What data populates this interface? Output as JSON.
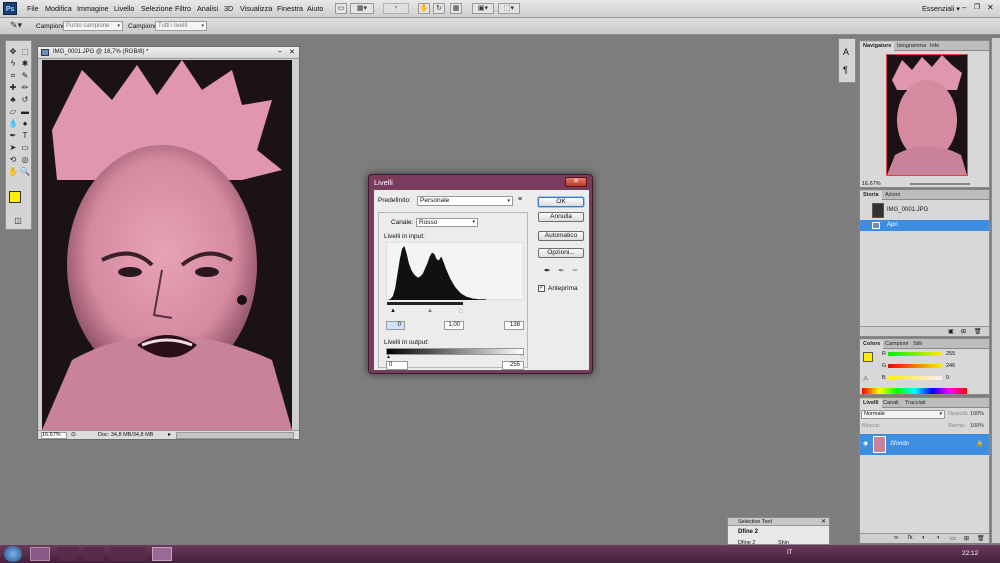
{
  "app": {
    "logo": "Ps"
  },
  "menu": [
    "File",
    "Modifica",
    "Immagine",
    "Livello",
    "Selezione",
    "Filtro",
    "Analisi",
    "3D",
    "Visualizza",
    "Finestra",
    "Aiuto"
  ],
  "workspace": "Essenziali",
  "options": {
    "campione_label": "Campione:",
    "campione_value": "Punto campione",
    "campione2_label": "Campione:",
    "campione2_value": "Tutti i livelli"
  },
  "document": {
    "title": "IMG_0001.JPG @ 16,7% (RGB/8) *",
    "zoom": "16,67%",
    "doc_info": "Doc: 34,8 MB/34,8 MB"
  },
  "dialog": {
    "title": "Livelli",
    "preset_label": "Predefinito:",
    "preset_value": "Personale",
    "channel_label": "Canale:",
    "channel_value": "Rosso",
    "input_label": "Livelli in input:",
    "input_black": "0",
    "input_gamma": "1,00",
    "input_white": "138",
    "output_label": "Livelli in output:",
    "output_black": "0",
    "output_white": "255",
    "buttons": {
      "ok": "OK",
      "cancel": "Annulla",
      "auto": "Automatico",
      "options": "Opzioni..."
    },
    "preview_label": "Anteprima",
    "preview_checked": true,
    "histogram": [
      0,
      0,
      2,
      6,
      18,
      40,
      62,
      78,
      82,
      70,
      55,
      46,
      40,
      36,
      34,
      36,
      40,
      48,
      56,
      66,
      72,
      70,
      62,
      60,
      66,
      58,
      48,
      40,
      32,
      26,
      20,
      16,
      12,
      9,
      7,
      5,
      4,
      3,
      2,
      2,
      1,
      1,
      1,
      1,
      0,
      0,
      0,
      0,
      0,
      0,
      0,
      0,
      0,
      0,
      0,
      0,
      0,
      0,
      0,
      0
    ]
  },
  "navigator": {
    "tabs": [
      "Navigatore",
      "Istogramma",
      "Info"
    ],
    "zoom": "16,67%"
  },
  "history": {
    "tabs": [
      "Storia",
      "Azioni"
    ],
    "items": [
      {
        "label": "IMG_0001.JPG"
      },
      {
        "label": "Apri"
      }
    ]
  },
  "color": {
    "tabs": [
      "Colore",
      "Campioni",
      "Stili"
    ],
    "r": {
      "label": "R",
      "value": "255"
    },
    "g": {
      "label": "G",
      "value": "246"
    },
    "b": {
      "label": "B",
      "value": "0"
    },
    "fg": "#ffee00"
  },
  "layers": {
    "tabs": [
      "Livelli",
      "Canali",
      "Tracciati"
    ],
    "blend": "Normale",
    "opacity_label": "Opacità:",
    "opacity": "100%",
    "lock_label": "Blocca:",
    "fill_label": "Riemp.:",
    "fill": "100%",
    "layer_name": "Sfondo"
  },
  "selective_tool": {
    "title": "Selective Tool",
    "row1": "Dfine 2",
    "row2": "Dfine 2",
    "row2b": "Shin"
  },
  "taskbar": {
    "lang": "IT",
    "time": "22:12"
  }
}
